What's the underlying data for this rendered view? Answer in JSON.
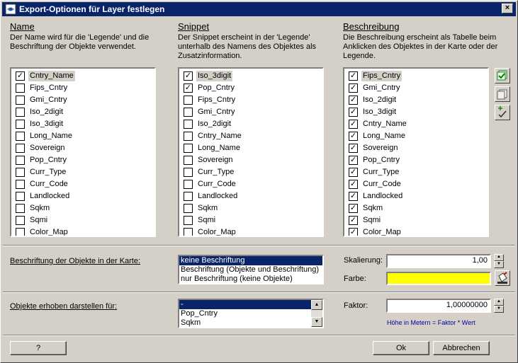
{
  "window": {
    "title": "Export-Optionen für Layer festlegen",
    "close_glyph": "×"
  },
  "name_section": {
    "heading": "Name",
    "description": "Der Name wird für die 'Legende' und die Beschriftung der Objekte verwendet.",
    "items": [
      {
        "label": "Cntry_Name",
        "checked": true,
        "selected": true
      },
      {
        "label": "Fips_Cntry",
        "checked": false
      },
      {
        "label": "Gmi_Cntry",
        "checked": false
      },
      {
        "label": "Iso_2digit",
        "checked": false
      },
      {
        "label": "Iso_3digit",
        "checked": false
      },
      {
        "label": "Long_Name",
        "checked": false
      },
      {
        "label": "Sovereign",
        "checked": false
      },
      {
        "label": "Pop_Cntry",
        "checked": false
      },
      {
        "label": "Curr_Type",
        "checked": false
      },
      {
        "label": "Curr_Code",
        "checked": false
      },
      {
        "label": "Landlocked",
        "checked": false
      },
      {
        "label": "Sqkm",
        "checked": false
      },
      {
        "label": "Sqmi",
        "checked": false
      },
      {
        "label": "Color_Map",
        "checked": false
      }
    ]
  },
  "snippet_section": {
    "heading": "Snippet",
    "description": "Der Snippet erscheint in der 'Legende' unterhalb des Namens des Objektes als Zusatzinformation.",
    "items": [
      {
        "label": "Iso_3digit",
        "checked": true,
        "selected": true
      },
      {
        "label": "Pop_Cntry",
        "checked": true
      },
      {
        "label": "Fips_Cntry",
        "checked": false
      },
      {
        "label": "Gmi_Cntry",
        "checked": false
      },
      {
        "label": "Iso_2digit",
        "checked": false
      },
      {
        "label": "Cntry_Name",
        "checked": false
      },
      {
        "label": "Long_Name",
        "checked": false
      },
      {
        "label": "Sovereign",
        "checked": false
      },
      {
        "label": "Curr_Type",
        "checked": false
      },
      {
        "label": "Curr_Code",
        "checked": false
      },
      {
        "label": "Landlocked",
        "checked": false
      },
      {
        "label": "Sqkm",
        "checked": false
      },
      {
        "label": "Sqmi",
        "checked": false
      },
      {
        "label": "Color_Map",
        "checked": false
      }
    ]
  },
  "description_section": {
    "heading": "Beschreibung",
    "description": "Die Beschreibung erscheint als Tabelle beim Anklicken des Objektes in der Karte oder der Legende.",
    "items": [
      {
        "label": "Fips_Cntry",
        "checked": true,
        "selected": true
      },
      {
        "label": "Gmi_Cntry",
        "checked": true
      },
      {
        "label": "Iso_2digit",
        "checked": true
      },
      {
        "label": "Iso_3digit",
        "checked": true
      },
      {
        "label": "Cntry_Name",
        "checked": true
      },
      {
        "label": "Long_Name",
        "checked": true
      },
      {
        "label": "Sovereign",
        "checked": true
      },
      {
        "label": "Pop_Cntry",
        "checked": true
      },
      {
        "label": "Curr_Type",
        "checked": true
      },
      {
        "label": "Curr_Code",
        "checked": true
      },
      {
        "label": "Landlocked",
        "checked": true
      },
      {
        "label": "Sqkm",
        "checked": true
      },
      {
        "label": "Sqmi",
        "checked": true
      },
      {
        "label": "Color_Map",
        "checked": true
      }
    ],
    "tool_icons": [
      "check-all-icon",
      "copy-icon",
      "sort-icon"
    ]
  },
  "labeling": {
    "label": "Beschriftung der Objekte in der Karte:",
    "options": [
      "keine Beschriftung",
      "Beschriftung (Objekte und Beschriftung)",
      "nur Beschriftung (keine Objekte)"
    ],
    "selected_index": 0
  },
  "scaling": {
    "label": "Skalierung:",
    "value": "1,00"
  },
  "color": {
    "label": "Farbe:",
    "value": "#ffff00"
  },
  "elevation": {
    "label": "Objekte erhoben darstellen für:",
    "options": [
      "-",
      "Pop_Cntry",
      "Sqkm"
    ],
    "selected_index": 0
  },
  "factor": {
    "label": "Faktor:",
    "value": "1,00000000",
    "hint": "Höhe in Metern = Faktor * Wert"
  },
  "buttons": {
    "help": "?",
    "ok": "Ok",
    "cancel": "Abbrechen"
  }
}
